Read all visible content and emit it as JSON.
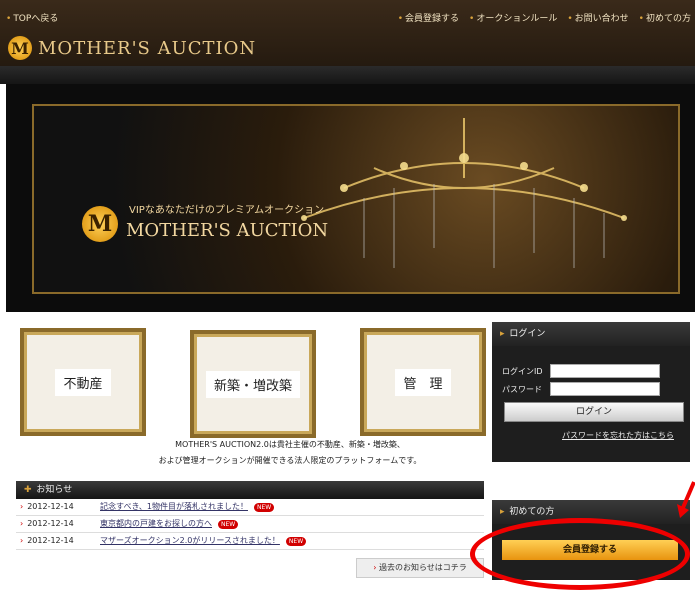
{
  "topbar": {
    "back": "TOPへ戻る",
    "nav": [
      "会員登録する",
      "オークションルール",
      "お問い合わせ",
      "初めての方"
    ],
    "brand": "MOTHER'S AUCTION"
  },
  "hero": {
    "tagline": "VIPなあなただけのプレミアムオークション",
    "brand": "MOTHER'S AUCTION"
  },
  "categories": [
    "不動産",
    "新築・増改築",
    "管　理"
  ],
  "description": [
    "MOTHER'S AUCTION2.0は貴社主催の不動産、新築・増改築、",
    "および管理オークションが開催できる法人限定のプラットフォームです。"
  ],
  "login": {
    "title": "ログイン",
    "id_label": "ログインID",
    "password_label": "パスワード",
    "id_value": "",
    "password_value": "",
    "button": "ログイン",
    "forgot": "パスワードを忘れた方はこちら"
  },
  "notice": {
    "title": "お知らせ",
    "items": [
      {
        "date": "2012-12-14",
        "text": "記念すべき、1物件目が落札されました！",
        "badge": "NEW"
      },
      {
        "date": "2012-12-14",
        "text": "東京都内の戸建をお探しの方へ",
        "badge": "NEW"
      },
      {
        "date": "2012-12-14",
        "text": "マザーズオークション2.0がリリースされました！",
        "badge": "NEW"
      }
    ],
    "past": "過去のお知らせはコチラ"
  },
  "first_time": {
    "title": "初めての方",
    "button": "会員登録する"
  },
  "colors": {
    "accent_gold": "#e8930f",
    "annotation_red": "#e00000",
    "header_dark": "#2a1e12"
  }
}
